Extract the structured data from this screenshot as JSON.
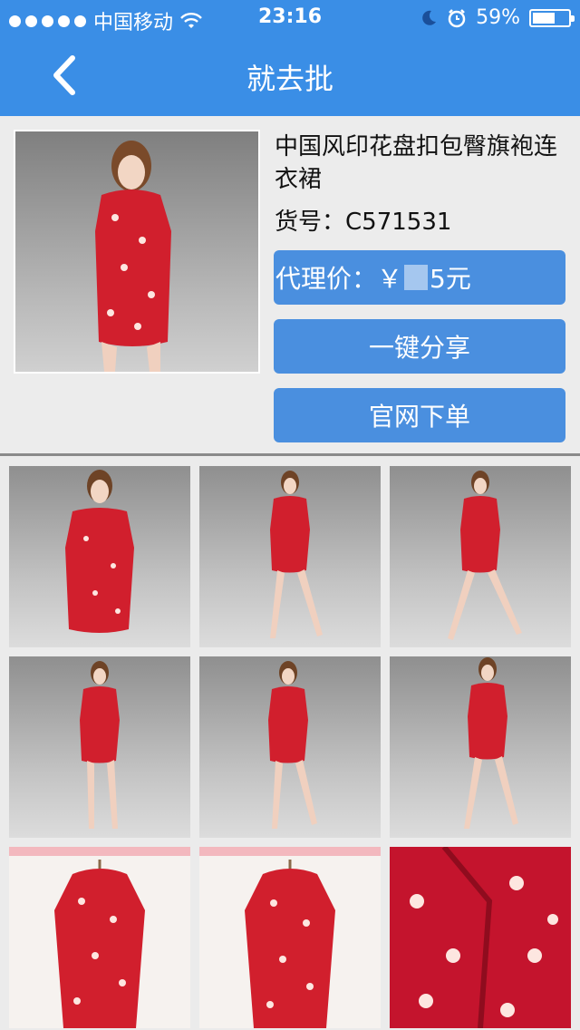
{
  "status_bar": {
    "carrier": "中国移动",
    "time": "23:16",
    "battery": "59%"
  },
  "nav": {
    "title": "就去批"
  },
  "product": {
    "title": "中国风印花盘扣包臀旗袍连衣裙",
    "sku": "货号：C571531",
    "price_label": "代理价：￥",
    "price_suffix": "5元",
    "share_label": "一键分享",
    "order_label": "官网下单"
  },
  "colors": {
    "accent": "#3a8ee6",
    "button": "#4a8fdf",
    "dress": "#d11f2d"
  },
  "gallery": {
    "count": 9
  }
}
